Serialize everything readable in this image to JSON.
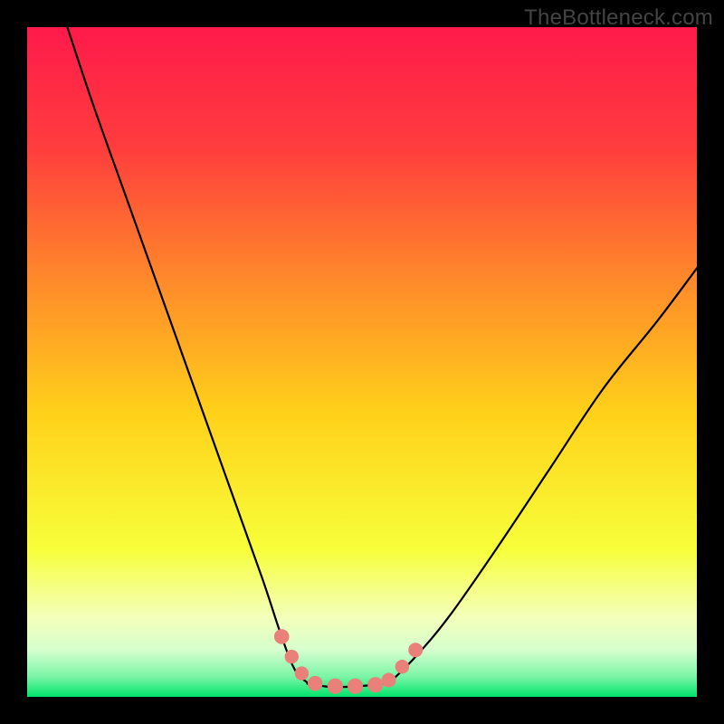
{
  "watermark": "TheBottleneck.com",
  "chart_data": {
    "type": "line",
    "title": "",
    "xlabel": "",
    "ylabel": "",
    "xlim": [
      0,
      100
    ],
    "ylim": [
      0,
      100
    ],
    "grid": false,
    "background_gradient": {
      "top_color": "#ff1a4b",
      "mid_colors": [
        "#ff6a2a",
        "#ffd21a",
        "#f7ff3a"
      ],
      "bottom_color": "#00e46a"
    },
    "series": [
      {
        "name": "curve-left",
        "x": [
          6,
          10,
          15,
          20,
          25,
          30,
          35,
          38,
          40,
          42
        ],
        "y": [
          100,
          88,
          74,
          60,
          46,
          32,
          18,
          9,
          4,
          2
        ]
      },
      {
        "name": "valley-floor",
        "x": [
          42,
          45,
          48,
          51,
          54
        ],
        "y": [
          2,
          1.5,
          1.5,
          1.7,
          2
        ]
      },
      {
        "name": "curve-right",
        "x": [
          54,
          58,
          63,
          70,
          78,
          86,
          94,
          100
        ],
        "y": [
          2,
          6,
          12,
          22,
          34,
          46,
          56,
          64
        ]
      }
    ],
    "markers": [
      {
        "name": "marker-left-1",
        "x": 38,
        "y": 9,
        "r": 2.6
      },
      {
        "name": "marker-left-2",
        "x": 39.5,
        "y": 6,
        "r": 2.4
      },
      {
        "name": "marker-left-3",
        "x": 41,
        "y": 3.5,
        "r": 2.4
      },
      {
        "name": "marker-floor-1",
        "x": 43,
        "y": 2,
        "r": 2.6
      },
      {
        "name": "marker-floor-2",
        "x": 46,
        "y": 1.6,
        "r": 2.7
      },
      {
        "name": "marker-floor-3",
        "x": 49,
        "y": 1.6,
        "r": 2.7
      },
      {
        "name": "marker-floor-4",
        "x": 52,
        "y": 1.8,
        "r": 2.7
      },
      {
        "name": "marker-right-1",
        "x": 54,
        "y": 2.5,
        "r": 2.5
      },
      {
        "name": "marker-right-2",
        "x": 56,
        "y": 4.5,
        "r": 2.4
      },
      {
        "name": "marker-right-3",
        "x": 58,
        "y": 7,
        "r": 2.5
      }
    ],
    "marker_color": "#e98079",
    "line_color": "#000000",
    "line_width": 2.2
  }
}
